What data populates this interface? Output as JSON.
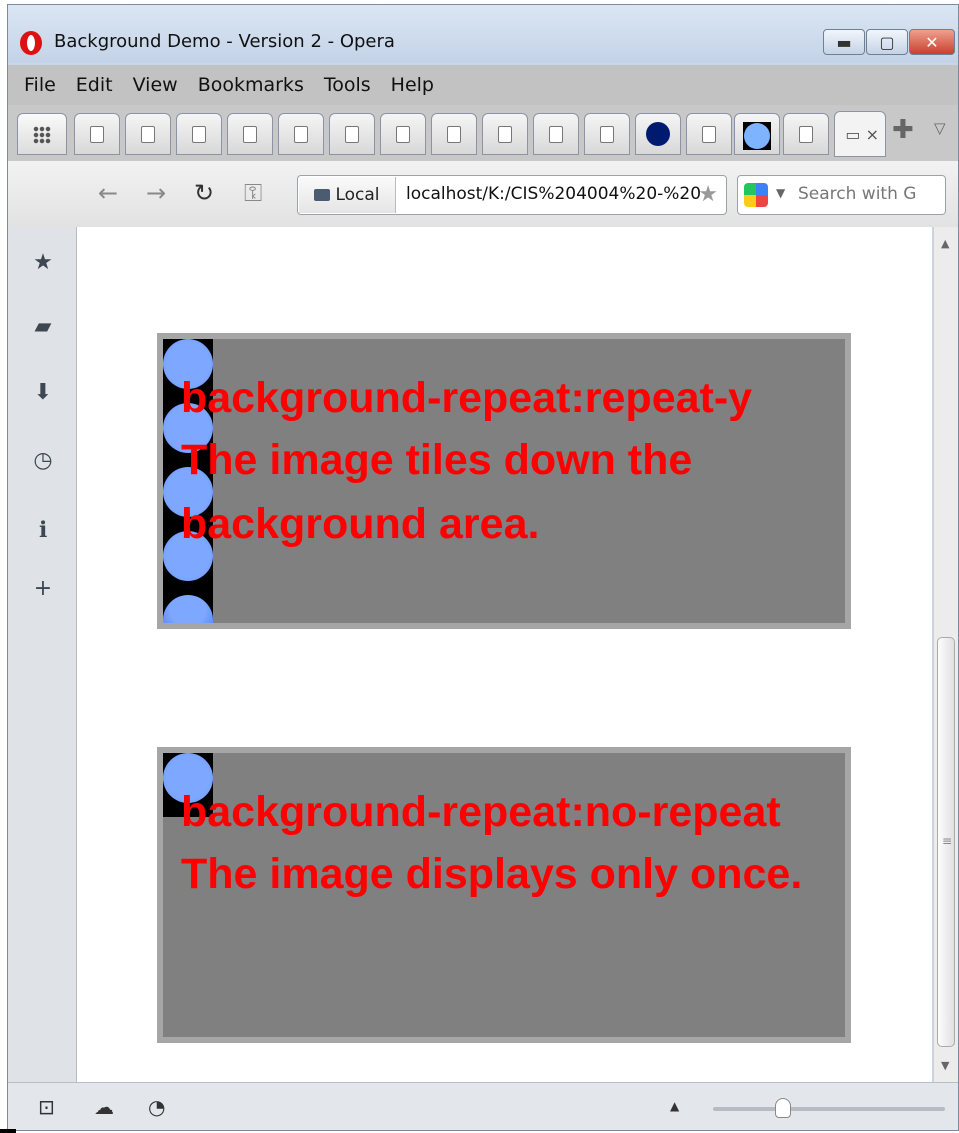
{
  "window": {
    "title": "Background Demo - Version 2 - Opera",
    "buttons": {
      "minimize": "▬",
      "maximize": "▢",
      "close": "✕"
    }
  },
  "menu": [
    "File",
    "Edit",
    "View",
    "Bookmarks",
    "Tools",
    "Help"
  ],
  "tabs": {
    "active_label": "▭ ×",
    "new_tab_icon": "✚",
    "tab_menu_icon": "▽"
  },
  "address": {
    "back": "←",
    "forward": "→",
    "reload": "↻",
    "key": "⚿",
    "local_label": "Local",
    "url": "localhost/K:/CIS%204004%20-%20",
    "bookmark_star": "★",
    "search_caret": "▼",
    "search_placeholder": "Search with G"
  },
  "sidebar": {
    "icons": [
      "star-icon",
      "notes-icon",
      "downloads-icon",
      "history-icon",
      "info-icon",
      "add-panel-icon"
    ],
    "glyphs": [
      "★",
      "▰",
      "⬇",
      "◷",
      "ℹ",
      "+"
    ]
  },
  "content": {
    "box1": {
      "lines": [
        "background-repeat:repeat-y",
        "The image tiles down the",
        "background area."
      ]
    },
    "box2": {
      "lines": [
        "background-repeat:no-repeat",
        "The image displays only once."
      ]
    }
  },
  "scrollbar": {
    "up": "▲",
    "grip": "≡",
    "down": "▼"
  },
  "statusbar": {
    "panel_toggle": "⊡",
    "unite": "☁",
    "turbo": "◔",
    "zoom_arrow": "▲",
    "zoom_level_fraction": 0.3
  },
  "colors": {
    "text_red": "#ff0000",
    "box_gray": "#808080",
    "box_border": "#a6a6a6",
    "tile_blue": "#7ea8ff"
  }
}
